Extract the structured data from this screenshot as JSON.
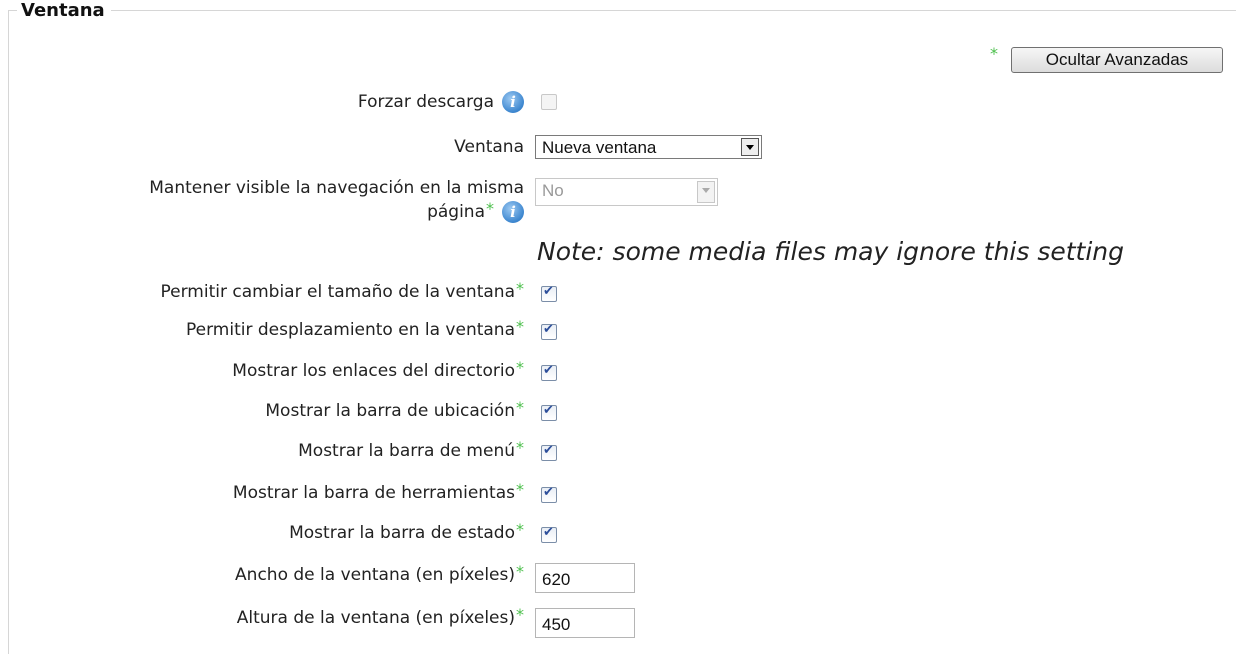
{
  "section": {
    "legend": "Ventana"
  },
  "advanced": {
    "button_label": "Ocultar Avanzadas",
    "star": "*"
  },
  "fields": {
    "force_download": {
      "label": "Forzar descarga",
      "checked": false
    },
    "window": {
      "label": "Ventana",
      "value": "Nueva ventana"
    },
    "keep_nav": {
      "label_line1": "Mantener visible la navegación en la misma",
      "label_line2": "página",
      "value": "No"
    },
    "note": "Note: some media files may ignore this setting",
    "resizable": {
      "label": "Permitir cambiar el tamaño de la ventana",
      "checked": true
    },
    "scrollbars": {
      "label": "Permitir desplazamiento en la ventana",
      "checked": true
    },
    "directories": {
      "label": "Mostrar los enlaces del directorio",
      "checked": true
    },
    "location": {
      "label": "Mostrar la barra de ubicación",
      "checked": true
    },
    "menubar": {
      "label": "Mostrar la barra de menú",
      "checked": true
    },
    "toolbar": {
      "label": "Mostrar la barra de herramientas",
      "checked": true
    },
    "status": {
      "label": "Mostrar la barra de estado",
      "checked": true
    },
    "width": {
      "label": "Ancho de la ventana (en píxeles)",
      "value": "620"
    },
    "height": {
      "label": "Altura de la ventana (en píxeles)",
      "value": "450"
    }
  },
  "colors": {
    "required_star": "#4bbf4b",
    "info_icon": "#3c86cf"
  }
}
